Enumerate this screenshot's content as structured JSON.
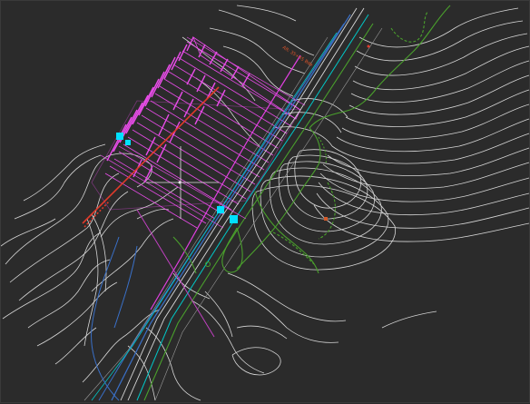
{
  "drawing": {
    "background": "#2b2b2b",
    "layers": {
      "contour": "#d8d8d8",
      "alignment": "#e040e0",
      "grading": "#4aa02c",
      "utility_cyan": "#00d0d0",
      "utility_blue": "#3a70c8",
      "hatch": "#e84ce8",
      "red_line": "#e03a2a"
    },
    "annotations": {
      "station_label": "Alt: 35+45 Bde"
    },
    "markers": [
      {
        "name": "survey-point-west",
        "color": "#00e0ff"
      },
      {
        "name": "survey-point-center",
        "color": "#00e0ff"
      },
      {
        "name": "survey-point-east",
        "color": "#00e0ff"
      }
    ]
  }
}
